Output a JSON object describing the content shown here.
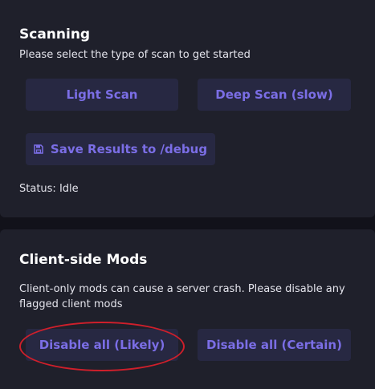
{
  "scanning": {
    "title": "Scanning",
    "description": "Please select the type of scan to get started",
    "light_scan_label": "Light Scan",
    "deep_scan_label": "Deep Scan (slow)",
    "save_results_label": "Save Results to /debug",
    "save_icon": "floppy-disk-icon",
    "status_label": "Status:",
    "status_value": "Idle"
  },
  "client_mods": {
    "title": "Client-side Mods",
    "description": "Client-only mods can cause a server crash. Please disable any flagged client mods",
    "disable_likely_label": "Disable all (Likely)",
    "disable_certain_label": "Disable all (Certain)"
  },
  "colors": {
    "background": "#12121a",
    "card": "#1f202b",
    "button_bg": "#272842",
    "button_text": "#7b6ee6",
    "annotation": "#cf1f2b"
  }
}
